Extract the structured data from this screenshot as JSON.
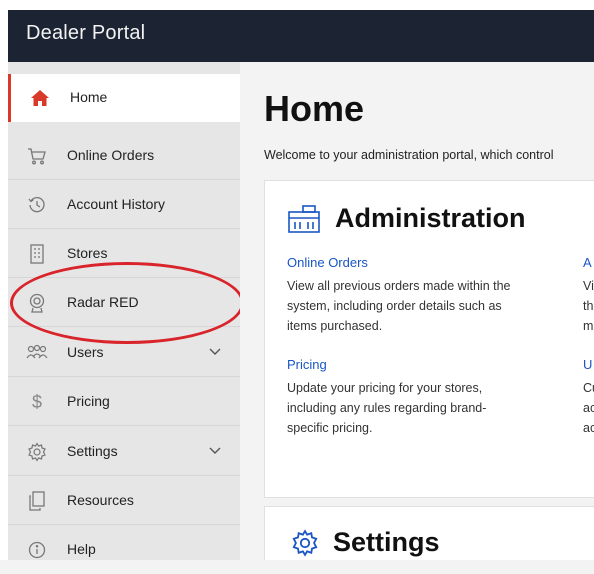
{
  "header": {
    "title": "Dealer Portal"
  },
  "sidebar": {
    "items": [
      {
        "label": "Home",
        "icon": "home-icon",
        "active": true
      },
      {
        "label": "Online Orders",
        "icon": "cart-icon"
      },
      {
        "label": "Account History",
        "icon": "history-icon"
      },
      {
        "label": "Stores",
        "icon": "store-icon"
      },
      {
        "label": "Radar RED",
        "icon": "radar-icon"
      },
      {
        "label": "Users",
        "icon": "users-icon",
        "expandable": true
      },
      {
        "label": "Pricing",
        "icon": "dollar-icon"
      },
      {
        "label": "Settings",
        "icon": "gear-icon",
        "expandable": true
      },
      {
        "label": "Resources",
        "icon": "copy-icon"
      },
      {
        "label": "Help",
        "icon": "info-icon"
      }
    ]
  },
  "main": {
    "title": "Home",
    "welcome": "Welcome to your administration portal, which control",
    "admin_card": {
      "title": "Administration",
      "sections": [
        {
          "link": "Online Orders",
          "desc_lines": [
            "View all previous orders made within the",
            "system, including order details such as",
            "items purchased."
          ]
        },
        {
          "link": "Pricing",
          "desc_lines": [
            "Update your pricing for your stores,",
            "including any rules regarding brand-",
            "specific pricing."
          ]
        }
      ],
      "right_sections": [
        {
          "link": "A",
          "desc_lines": [
            "Vi",
            "th",
            "m"
          ]
        },
        {
          "link": "U",
          "desc_lines": [
            "Cu",
            "ac",
            "ac"
          ]
        }
      ]
    },
    "settings_card": {
      "title": "Settings"
    }
  },
  "colors": {
    "accent": "#d83a2a",
    "link": "#1a56c4",
    "topbar": "#1c2433",
    "highlight": "#d8242a"
  }
}
